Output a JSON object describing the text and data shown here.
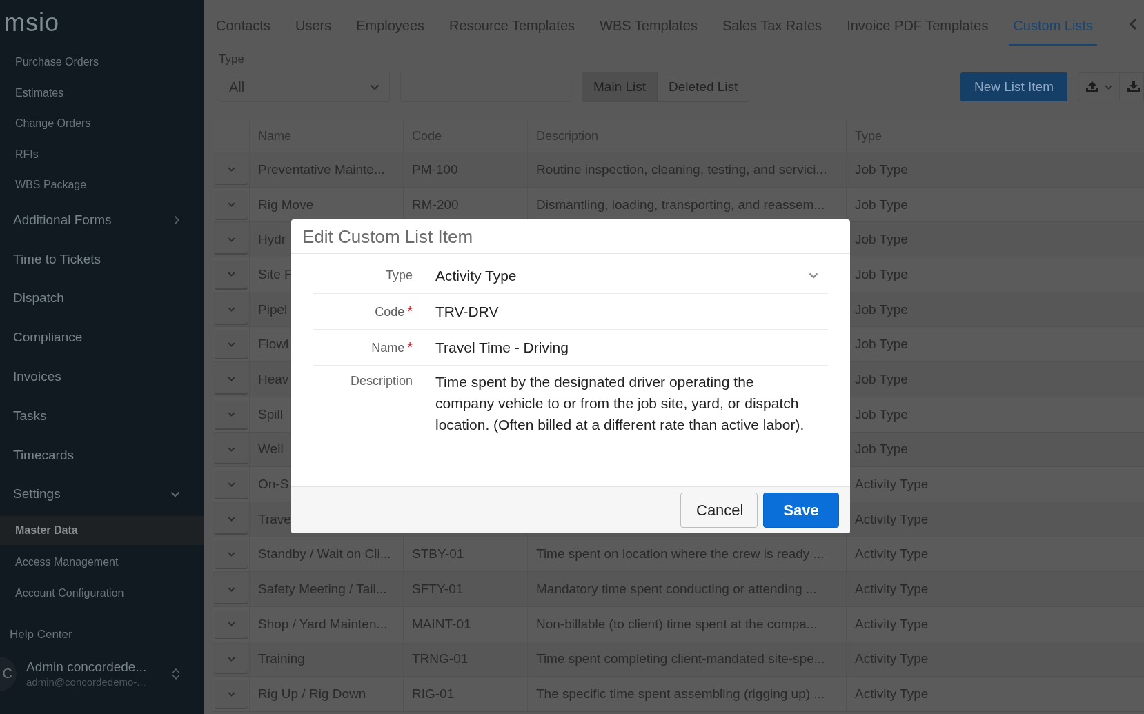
{
  "sidebar": {
    "logo": "msio",
    "items": [
      {
        "kind": "sub",
        "label": "Purchase Orders",
        "selected": false
      },
      {
        "kind": "sub",
        "label": "Estimates",
        "selected": false
      },
      {
        "kind": "sub",
        "label": "Change Orders",
        "selected": false
      },
      {
        "kind": "sub",
        "label": "RFIs",
        "selected": false
      },
      {
        "kind": "sub",
        "label": "WBS Package",
        "selected": false
      },
      {
        "kind": "group",
        "label": "Additional Forms",
        "expanded": false,
        "selected": false
      },
      {
        "kind": "main",
        "label": "Time to Tickets",
        "selected": false
      },
      {
        "kind": "main",
        "label": "Dispatch",
        "selected": false
      },
      {
        "kind": "main",
        "label": "Compliance",
        "selected": false
      },
      {
        "kind": "main",
        "label": "Invoices",
        "selected": false
      },
      {
        "kind": "main",
        "label": "Tasks",
        "selected": false
      },
      {
        "kind": "main",
        "label": "Timecards",
        "selected": false
      },
      {
        "kind": "group",
        "label": "Settings",
        "expanded": true,
        "selected": false
      },
      {
        "kind": "sub",
        "label": "Master Data",
        "selected": true
      },
      {
        "kind": "sub",
        "label": "Access Management",
        "selected": false
      },
      {
        "kind": "sub",
        "label": "Account Configuration",
        "selected": false
      }
    ],
    "help": "Help Center",
    "user": {
      "initial": "C",
      "name": "Admin concordede...",
      "email": "admin@concordedemo-..."
    }
  },
  "tabs": [
    {
      "label": "Contacts",
      "selected": false
    },
    {
      "label": "Users",
      "selected": false
    },
    {
      "label": "Employees",
      "selected": false
    },
    {
      "label": "Resource Templates",
      "selected": false
    },
    {
      "label": "WBS Templates",
      "selected": false
    },
    {
      "label": "Sales Tax Rates",
      "selected": false
    },
    {
      "label": "Invoice PDF Templates",
      "selected": false
    },
    {
      "label": "Custom Lists",
      "selected": true
    }
  ],
  "filter": {
    "label": "Type",
    "value": "All"
  },
  "list_toggle": [
    {
      "label": "Main List",
      "selected": true
    },
    {
      "label": "Deleted List",
      "selected": false
    }
  ],
  "new_button": "New List Item",
  "table": {
    "columns": [
      "Name",
      "Code",
      "Description",
      "Type"
    ],
    "rows": [
      {
        "name": "Preventative Mainte...",
        "code": "PM-100",
        "description": "Routine inspection, cleaning, testing, and servici...",
        "type": "Job Type"
      },
      {
        "name": "Rig Move",
        "code": "RM-200",
        "description": "Dismantling, loading, transporting, and reassem...",
        "type": "Job Type"
      },
      {
        "name": "Hydr",
        "type": "Job Type"
      },
      {
        "name": "Site F",
        "type": "Job Type"
      },
      {
        "name": "Pipel",
        "type": "Job Type"
      },
      {
        "name": "Flowl",
        "type": "Job Type"
      },
      {
        "name": "Heav",
        "type": "Job Type"
      },
      {
        "name": "Spill",
        "type": "Job Type"
      },
      {
        "name": "Well",
        "type": "Job Type"
      },
      {
        "name": "On-S",
        "type": "Activity Type"
      },
      {
        "name": "Trave",
        "type": "Activity Type"
      },
      {
        "name": "Standby / Wait on Cli...",
        "code": "STBY-01",
        "description": "Time spent on location where the crew is ready ...",
        "type": "Activity Type"
      },
      {
        "name": "Safety Meeting / Tail...",
        "code": "SFTY-01",
        "description": "Mandatory time spent conducting or attending ...",
        "type": "Activity Type"
      },
      {
        "name": "Shop / Yard Mainten...",
        "code": "MAINT-01",
        "description": "Non-billable (to client) time spent at the compa...",
        "type": "Activity Type"
      },
      {
        "name": "Training",
        "code": "TRNG-01",
        "description": "Time spent completing client-mandated site-spe...",
        "type": "Activity Type"
      },
      {
        "name": "Rig Up / Rig Down",
        "code": "RIG-01",
        "description": "The specific time spent assembling (rigging up) ...",
        "type": "Activity Type"
      }
    ]
  },
  "dialog": {
    "title": "Edit Custom List Item",
    "required_mark": "*",
    "fields": [
      {
        "kind": "select",
        "label": "Type",
        "value": "Activity Type",
        "required": false
      },
      {
        "kind": "text",
        "label": "Code",
        "value": "TRV-DRV",
        "required": true
      },
      {
        "kind": "text",
        "label": "Name",
        "value": "Travel Time - Driving",
        "required": true
      },
      {
        "kind": "textarea",
        "label": "Description",
        "value": "Time spent by the designated driver operating the company vehicle to or from the job site, yard, or dispatch location. (Often billed at a different rate than active labor).",
        "required": false
      }
    ],
    "buttons": [
      {
        "label": "Cancel",
        "kind": "secondary"
      },
      {
        "label": "Save",
        "kind": "primary"
      }
    ]
  }
}
